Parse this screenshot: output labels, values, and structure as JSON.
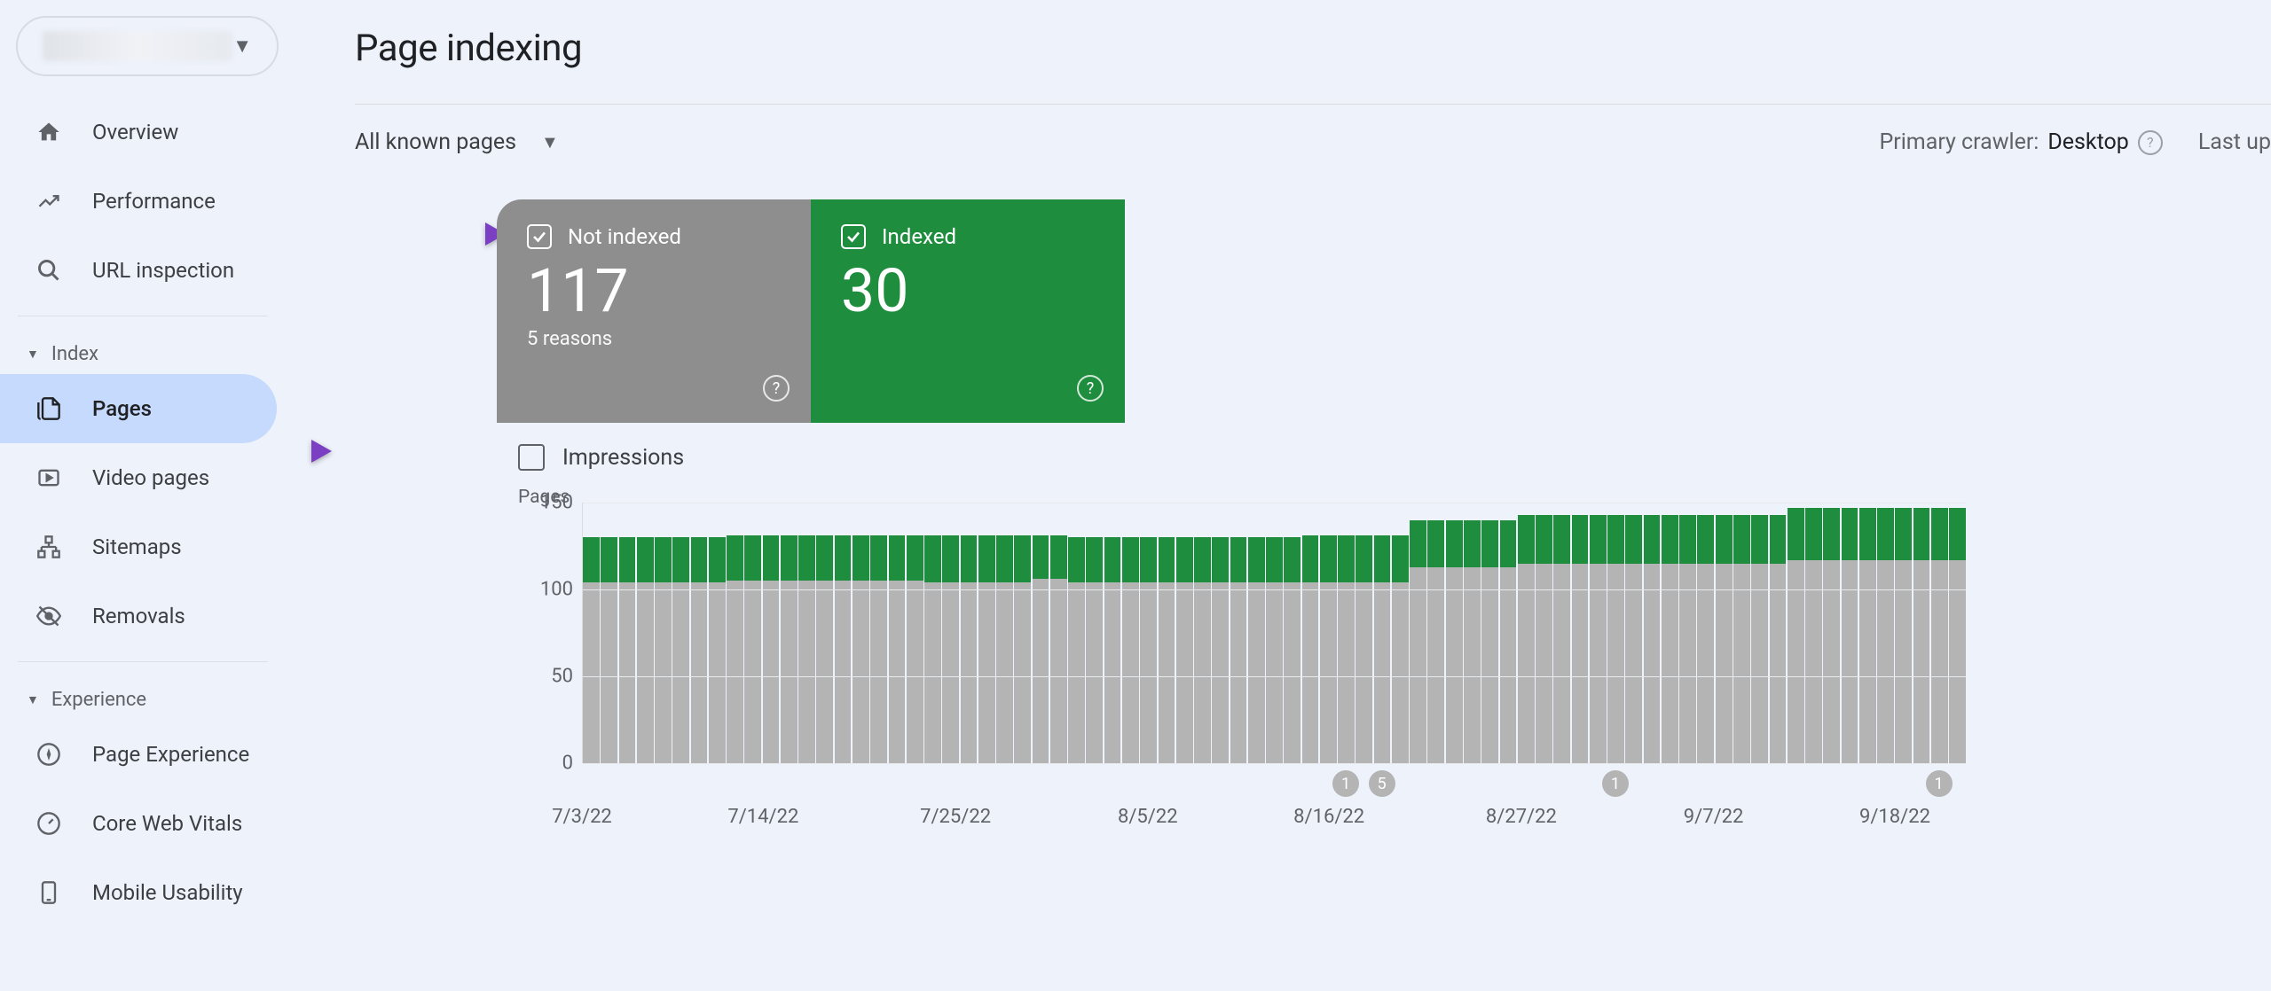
{
  "sidebar": {
    "property_name": "",
    "items": {
      "overview": "Overview",
      "performance": "Performance",
      "url_inspection": "URL inspection",
      "pages": "Pages",
      "video_pages": "Video pages",
      "sitemaps": "Sitemaps",
      "removals": "Removals",
      "page_experience": "Page Experience",
      "core_web_vitals": "Core Web Vitals",
      "mobile_usability": "Mobile Usability"
    },
    "sections": {
      "index": "Index",
      "experience": "Experience"
    }
  },
  "main": {
    "title": "Page indexing",
    "filter_dropdown": "All known pages",
    "crawler_label": "Primary crawler: ",
    "crawler_value": "Desktop",
    "last_updated": "Last up"
  },
  "cards": {
    "not_indexed": {
      "label": "Not indexed",
      "value": "117",
      "subtitle": "5 reasons"
    },
    "indexed": {
      "label": "Indexed",
      "value": "30"
    }
  },
  "impressions_label": "Impressions",
  "chart_data": {
    "type": "bar",
    "title": "",
    "ylabel": "Pages",
    "ylim": [
      0,
      150
    ],
    "y_ticks": [
      0,
      50,
      100,
      150
    ],
    "x_ticks": [
      "7/3/22",
      "7/14/22",
      "7/25/22",
      "8/5/22",
      "8/16/22",
      "8/27/22",
      "9/7/22",
      "9/18/22"
    ],
    "series": [
      {
        "name": "Not indexed",
        "color": "#b4b4b4"
      },
      {
        "name": "Indexed",
        "color": "#1e8e3e"
      }
    ],
    "bars": [
      {
        "ni": 104,
        "i": 26
      },
      {
        "ni": 104,
        "i": 26
      },
      {
        "ni": 104,
        "i": 26
      },
      {
        "ni": 104,
        "i": 26
      },
      {
        "ni": 104,
        "i": 26
      },
      {
        "ni": 104,
        "i": 26
      },
      {
        "ni": 104,
        "i": 26
      },
      {
        "ni": 104,
        "i": 26
      },
      {
        "ni": 105,
        "i": 26
      },
      {
        "ni": 105,
        "i": 26
      },
      {
        "ni": 105,
        "i": 26
      },
      {
        "ni": 105,
        "i": 26
      },
      {
        "ni": 105,
        "i": 26
      },
      {
        "ni": 105,
        "i": 26
      },
      {
        "ni": 105,
        "i": 26
      },
      {
        "ni": 105,
        "i": 26
      },
      {
        "ni": 105,
        "i": 26
      },
      {
        "ni": 105,
        "i": 26
      },
      {
        "ni": 105,
        "i": 26
      },
      {
        "ni": 104,
        "i": 27
      },
      {
        "ni": 104,
        "i": 27
      },
      {
        "ni": 104,
        "i": 27
      },
      {
        "ni": 104,
        "i": 27
      },
      {
        "ni": 104,
        "i": 27
      },
      {
        "ni": 104,
        "i": 27
      },
      {
        "ni": 106,
        "i": 25
      },
      {
        "ni": 106,
        "i": 25
      },
      {
        "ni": 104,
        "i": 26
      },
      {
        "ni": 104,
        "i": 26
      },
      {
        "ni": 104,
        "i": 26
      },
      {
        "ni": 104,
        "i": 26
      },
      {
        "ni": 104,
        "i": 26
      },
      {
        "ni": 104,
        "i": 26
      },
      {
        "ni": 104,
        "i": 26
      },
      {
        "ni": 104,
        "i": 26
      },
      {
        "ni": 104,
        "i": 26
      },
      {
        "ni": 104,
        "i": 26
      },
      {
        "ni": 104,
        "i": 26
      },
      {
        "ni": 104,
        "i": 26
      },
      {
        "ni": 104,
        "i": 26
      },
      {
        "ni": 104,
        "i": 27
      },
      {
        "ni": 104,
        "i": 27
      },
      {
        "ni": 104,
        "i": 27
      },
      {
        "ni": 104,
        "i": 27
      },
      {
        "ni": 104,
        "i": 27
      },
      {
        "ni": 104,
        "i": 27
      },
      {
        "ni": 113,
        "i": 27
      },
      {
        "ni": 113,
        "i": 27
      },
      {
        "ni": 113,
        "i": 27
      },
      {
        "ni": 113,
        "i": 27
      },
      {
        "ni": 113,
        "i": 27
      },
      {
        "ni": 113,
        "i": 27
      },
      {
        "ni": 115,
        "i": 28
      },
      {
        "ni": 115,
        "i": 28
      },
      {
        "ni": 115,
        "i": 28
      },
      {
        "ni": 115,
        "i": 28
      },
      {
        "ni": 115,
        "i": 28
      },
      {
        "ni": 115,
        "i": 28
      },
      {
        "ni": 115,
        "i": 28
      },
      {
        "ni": 115,
        "i": 28
      },
      {
        "ni": 115,
        "i": 28
      },
      {
        "ni": 115,
        "i": 28
      },
      {
        "ni": 115,
        "i": 28
      },
      {
        "ni": 115,
        "i": 28
      },
      {
        "ni": 115,
        "i": 28
      },
      {
        "ni": 115,
        "i": 28
      },
      {
        "ni": 115,
        "i": 28
      },
      {
        "ni": 117,
        "i": 30
      },
      {
        "ni": 117,
        "i": 30
      },
      {
        "ni": 117,
        "i": 30
      },
      {
        "ni": 117,
        "i": 30
      },
      {
        "ni": 117,
        "i": 30
      },
      {
        "ni": 117,
        "i": 30
      },
      {
        "ni": 117,
        "i": 30
      },
      {
        "ni": 117,
        "i": 30
      },
      {
        "ni": 117,
        "i": 30
      },
      {
        "ni": 117,
        "i": 30
      }
    ],
    "markers": [
      {
        "index": 42,
        "label": "1"
      },
      {
        "index": 44,
        "label": "5"
      },
      {
        "index": 57,
        "label": "1"
      },
      {
        "index": 75,
        "label": "1"
      }
    ]
  }
}
